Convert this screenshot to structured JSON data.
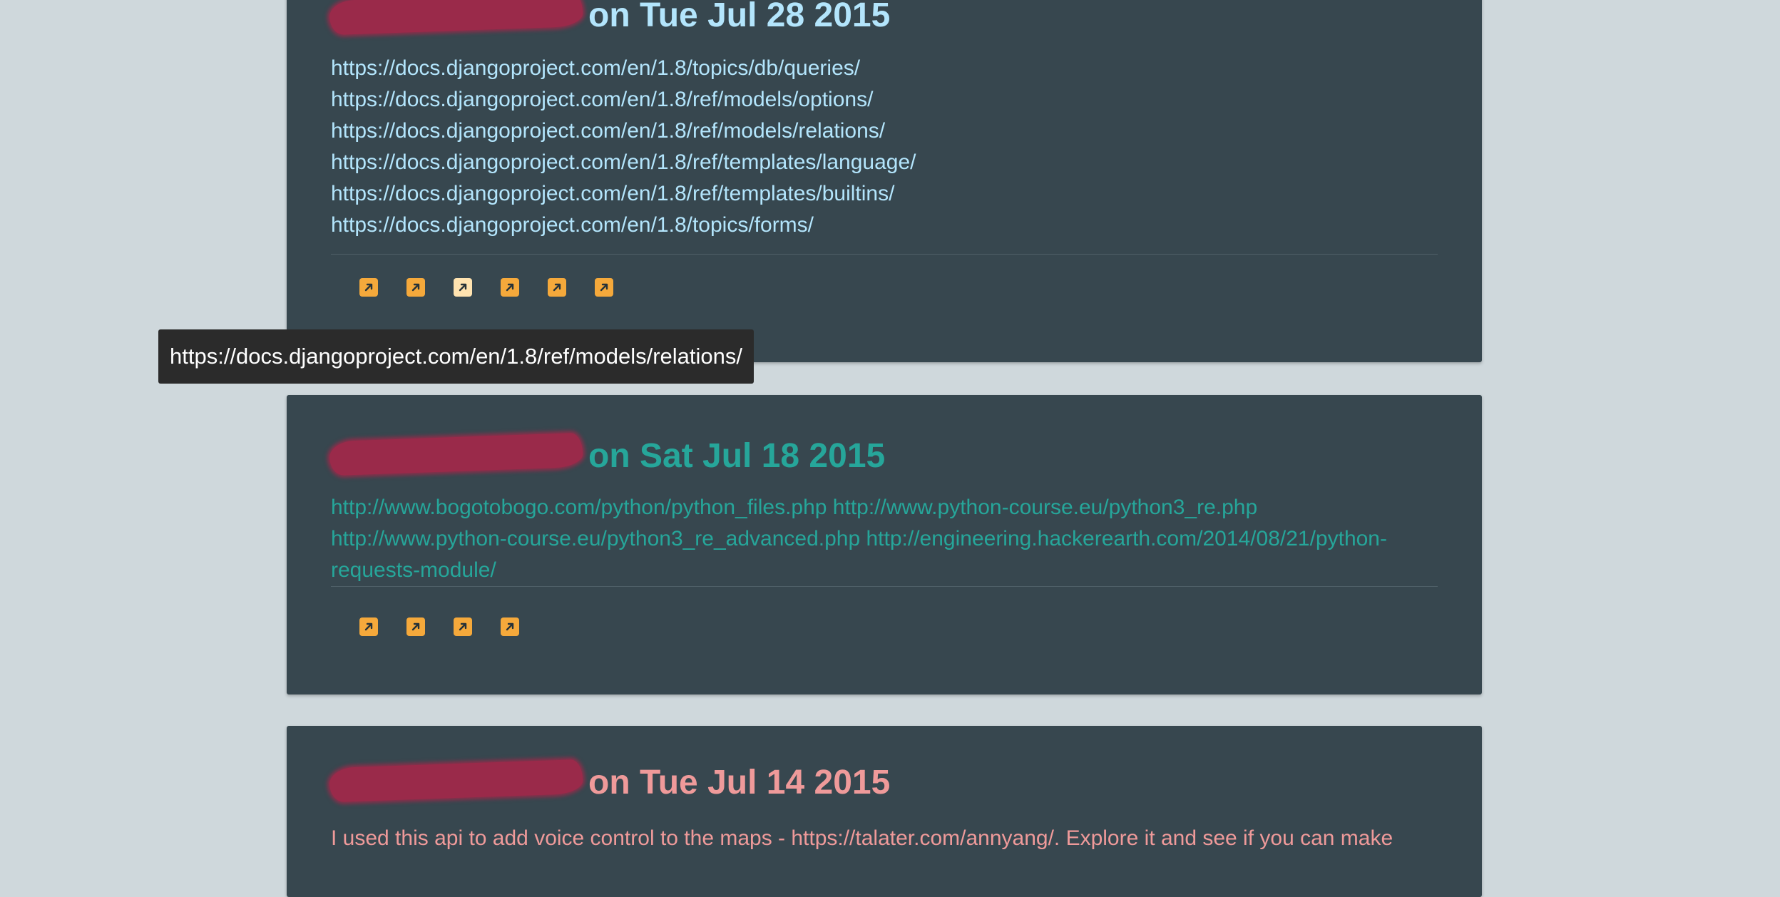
{
  "colors": {
    "page_background": "#cfd8dc",
    "card_background": "#37474f",
    "card1_text": "#b3e5fc",
    "card2_text": "#26a69a",
    "card3_text": "#ef9a9a",
    "icon_accent": "#f5a93b",
    "redaction": "#9a2a4a"
  },
  "cards": [
    {
      "date_text": "on Tue Jul 28 2015",
      "links": [
        "https://docs.djangoproject.com/en/1.8/topics/db/queries/",
        "https://docs.djangoproject.com/en/1.8/ref/models/options/",
        "https://docs.djangoproject.com/en/1.8/ref/models/relations/",
        "https://docs.djangoproject.com/en/1.8/ref/templates/language/",
        "https://docs.djangoproject.com/en/1.8/ref/templates/builtins/",
        "https://docs.djangoproject.com/en/1.8/topics/forms/"
      ],
      "icon_count": 6,
      "hovered_icon_index": 2
    },
    {
      "date_text": "on Sat Jul 18 2015",
      "body": "http://www.bogotobogo.com/python/python_files.php http://www.python-course.eu/python3_re.php http://www.python-course.eu/python3_re_advanced.php http://engineering.hackerearth.com/2014/08/21/python-requests-module/",
      "icon_count": 4
    },
    {
      "date_text": "on Tue Jul 14 2015",
      "body": "I used this api to add voice control to the maps - https://talater.com/annyang/. Explore it and see if you can make"
    }
  ],
  "tooltip": {
    "text": "https://docs.djangoproject.com/en/1.8/ref/models/relations/"
  },
  "icons": {
    "open_link": "external-link-icon",
    "redaction": "scribbled-out-name"
  }
}
